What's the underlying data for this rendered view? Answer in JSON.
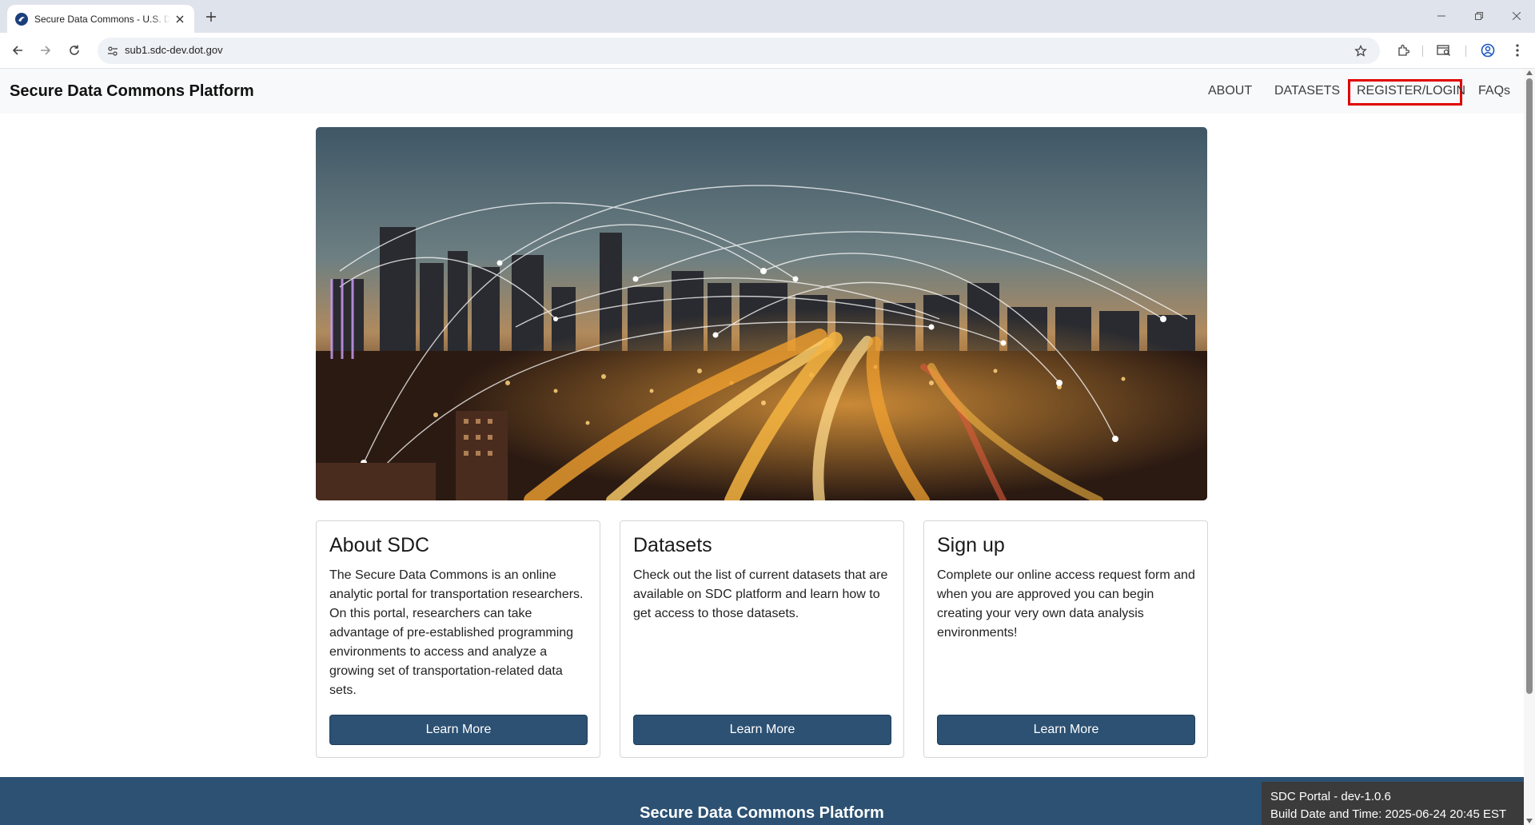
{
  "browser": {
    "tab_title": "Secure Data Commons - U.S. Department of Transportation",
    "url": "sub1.sdc-dev.dot.gov"
  },
  "navbar": {
    "brand": "Secure Data Commons Platform",
    "links": [
      "ABOUT",
      "DATASETS",
      "REGISTER/LOGIN",
      "FAQs"
    ],
    "highlighted": "REGISTER/LOGIN",
    "highlight_color": "#e00000"
  },
  "cards": [
    {
      "title": "About SDC",
      "text": "The Secure Data Commons is an online analytic portal for transportation researchers. On this portal, researchers can take advantage of pre-established programming environments to access and analyze a growing set of transportation-related data sets.",
      "button": "Learn More"
    },
    {
      "title": "Datasets",
      "text": "Check out the list of current datasets that are available on SDC platform and learn how to get access to those datasets.",
      "button": "Learn More"
    },
    {
      "title": "Sign up",
      "text": "Complete our online access request form and when you are approved you can begin creating your very own data analysis environments!",
      "button": "Learn More"
    }
  ],
  "footer": {
    "title": "Secure Data Commons Platform"
  },
  "build": {
    "version": "SDC Portal - dev-1.0.6",
    "date": "Build Date and Time: 2025-06-24 20:45 EST"
  },
  "colors": {
    "primary": "#2c5173",
    "navbar_bg": "#f8f9fa"
  }
}
